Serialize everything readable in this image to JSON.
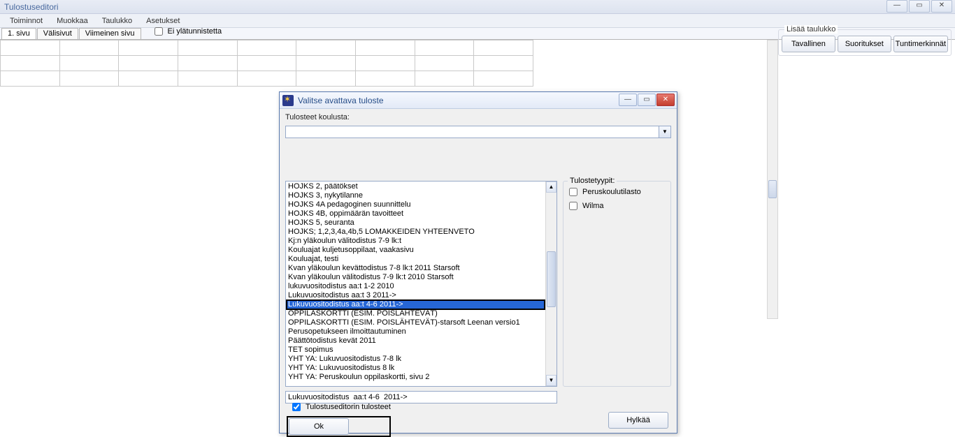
{
  "main": {
    "title": "Tulostuseditori"
  },
  "menu": {
    "items": [
      "Toiminnot",
      "Muokkaa",
      "Taulukko",
      "Asetukset"
    ]
  },
  "tabs": {
    "items": [
      "1. sivu",
      "Välisivut",
      "Viimeinen sivu"
    ],
    "no_header_label": "Ei ylätunnistetta"
  },
  "right": {
    "title": "Lisää taulukko",
    "buttons": [
      "Tavallinen",
      "Suoritukset",
      "Tuntimerkinnät"
    ]
  },
  "dialog": {
    "title": "Valitse avattava tuloste",
    "school_label": "Tulosteet koulusta:",
    "school_value": "",
    "types_title": "Tulostetyypit:",
    "types": [
      "Peruskoulutilasto",
      "Wilma"
    ],
    "list": [
      "HOJKS 2, päätökset",
      "HOJKS 3, nykytilanne",
      "HOJKS 4A pedagoginen suunnittelu",
      "HOJKS 4B, oppimäärän tavoitteet",
      "HOJKS 5, seuranta",
      "HOJKS; 1,2,3,4a,4b,5 LOMAKKEIDEN YHTEENVETO",
      "Kj:n yläkoulun välitodistus 7-9 lk:t",
      "Kouluajat kuljetusoppilaat, vaakasivu",
      "Kouluajat, testi",
      "Kvan yläkoulun kevättodistus 7-8 lk:t 2011 Starsoft",
      "Kvan yläkoulun välitodistus 7-9 lk:t 2010 Starsoft",
      "lukuvuositodistus  aa:t 1-2  2010",
      "Lukuvuositodistus  aa:t 3  2011->",
      "Lukuvuositodistus  aa:t 4-6  2011->",
      "OPPILASKORTTI (ESIM. POISLÄHTEVÄT)",
      "OPPILASKORTTI (ESIM. POISLÄHTEVÄT)-starsoft Leenan versio1",
      "Perusopetukseen ilmoittautuminen",
      "Päättötodistus kevät 2011",
      "TET sopimus",
      "YHT YA: Lukuvuositodistus 7-8 lk",
      "YHT YA: Lukuvuositodistus 8 lk",
      "YHT YA: Peruskoulun oppilaskortti, sivu 2"
    ],
    "selected_index": 13,
    "selected_value": "Lukuvuositodistus  aa:t 4-6  2011->",
    "editor_checkbox": "Tulostuseditorin tulosteet",
    "ok_label": "Ok",
    "cancel_label": "Hylkää"
  }
}
